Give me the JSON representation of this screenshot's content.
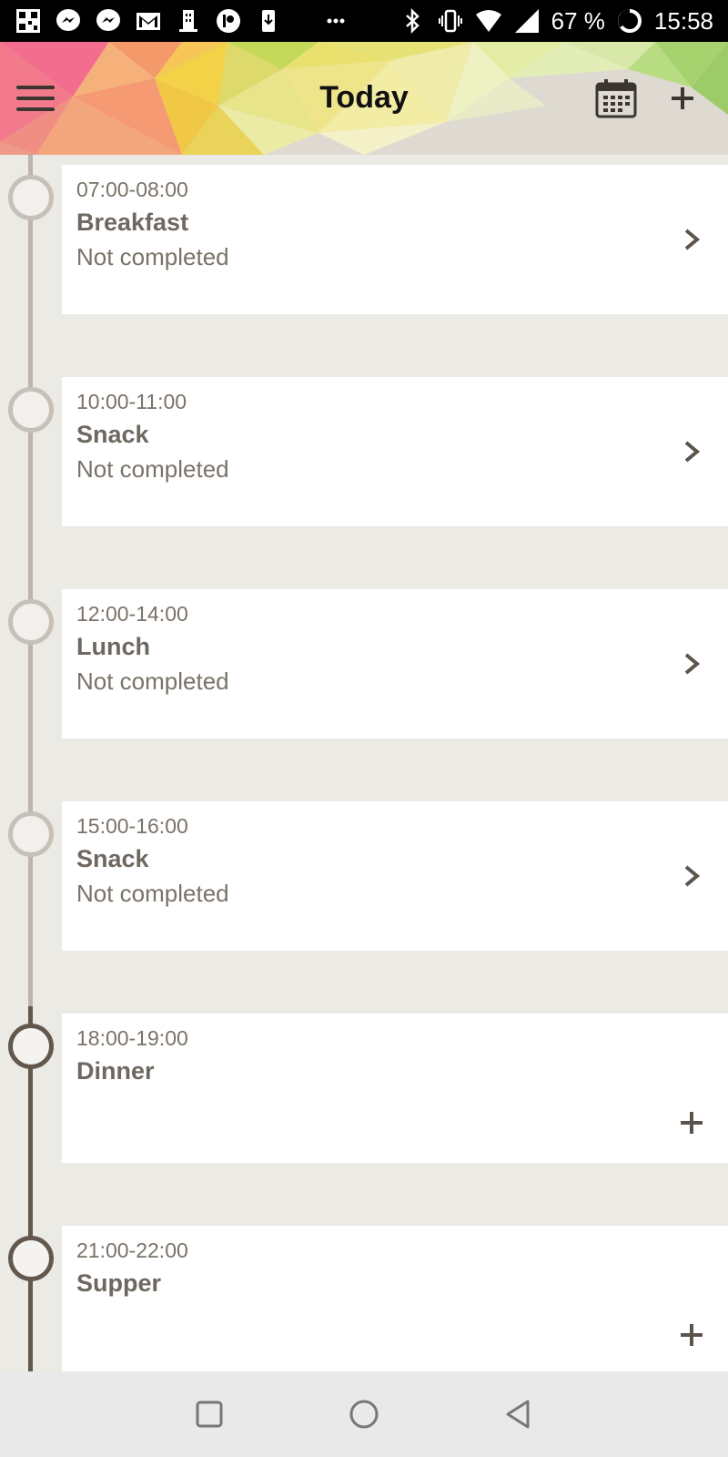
{
  "status_bar": {
    "battery": "67 %",
    "time": "15:58",
    "left_icons": [
      "qr-icon",
      "messenger-icon",
      "messenger-icon",
      "gmail-icon",
      "building-icon",
      "patreon-icon",
      "download-icon",
      "more-icon"
    ],
    "right_icons": [
      "bluetooth-icon",
      "vibrate-icon",
      "wifi-icon",
      "signal-icon",
      "battery-icon"
    ]
  },
  "header": {
    "title": "Today",
    "menu_icon": "hamburger-menu-icon",
    "calendar_icon": "calendar-icon",
    "add_icon": "plus-icon"
  },
  "entries": [
    {
      "time": "07:00-08:00",
      "meal": "Breakfast",
      "status": "Not completed",
      "action": "chevron-right-icon",
      "state": "scheduled"
    },
    {
      "time": "10:00-11:00",
      "meal": "Snack",
      "status": "Not completed",
      "action": "chevron-right-icon",
      "state": "scheduled"
    },
    {
      "time": "12:00-14:00",
      "meal": "Lunch",
      "status": "Not completed",
      "action": "chevron-right-icon",
      "state": "scheduled"
    },
    {
      "time": "15:00-16:00",
      "meal": "Snack",
      "status": "Not completed",
      "action": "chevron-right-icon",
      "state": "scheduled"
    },
    {
      "time": "18:00-19:00",
      "meal": "Dinner",
      "status": "",
      "action": "plus-icon",
      "state": "pending"
    },
    {
      "time": "21:00-22:00",
      "meal": "Supper",
      "status": "",
      "action": "plus-icon",
      "state": "pending"
    }
  ],
  "nav_bar": {
    "buttons": [
      "recents-square-icon",
      "home-circle-icon",
      "back-triangle-icon"
    ]
  },
  "colors": {
    "background": "#ECEAE4",
    "card": "#FFFFFF",
    "timeline_light": "#BDB5AC",
    "timeline_dark": "#62584E",
    "text_muted": "#7A7268"
  }
}
